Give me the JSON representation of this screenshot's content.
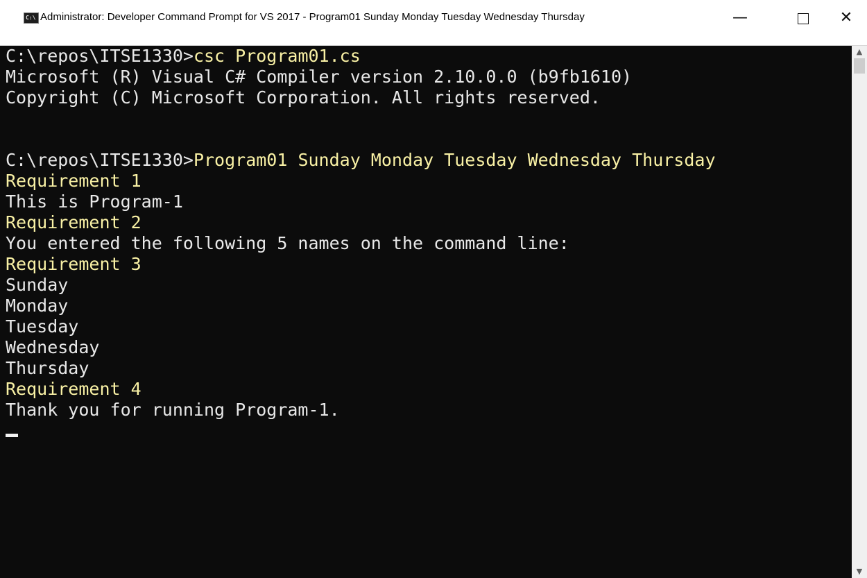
{
  "window": {
    "title": "Administrator: Developer Command Prompt for VS 2017 - Program01  Sunday Monday Tuesday Wednesday Thursday",
    "app_icon_text": "C:\\",
    "controls": {
      "minimize": "—",
      "close": "✕"
    }
  },
  "console": {
    "lines": [
      {
        "prompt": "C:\\repos\\ITSE1330>",
        "command": "csc Program01.cs"
      },
      {
        "text": "Microsoft (R) Visual C# Compiler version 2.10.0.0 (b9fb1610)"
      },
      {
        "text": "Copyright (C) Microsoft Corporation. All rights reserved."
      },
      {
        "text": ""
      },
      {
        "text": ""
      },
      {
        "prompt": "C:\\repos\\ITSE1330>",
        "command": "Program01 Sunday Monday Tuesday Wednesday Thursday"
      },
      {
        "highlight": "Requirement 1"
      },
      {
        "text": "This is Program-1"
      },
      {
        "highlight": "Requirement 2"
      },
      {
        "text": "You entered the following 5 names on the command line:"
      },
      {
        "highlight": "Requirement 3"
      },
      {
        "text": "Sunday"
      },
      {
        "text": "Monday"
      },
      {
        "text": "Tuesday"
      },
      {
        "text": "Wednesday"
      },
      {
        "text": "Thursday"
      },
      {
        "highlight": "Requirement 4"
      },
      {
        "text": "Thank you for running Program-1."
      }
    ]
  },
  "colors": {
    "console_bg": "#0c0c0c",
    "console_text": "#e8e8e8",
    "highlight_text": "#f9f1a5"
  },
  "icons": {
    "app": "command-prompt-icon",
    "minimize": "minimize-icon",
    "maximize": "maximize-icon",
    "close": "close-icon",
    "scroll_up": "scroll-up-arrow-icon",
    "scroll_down": "scroll-down-arrow-icon"
  }
}
